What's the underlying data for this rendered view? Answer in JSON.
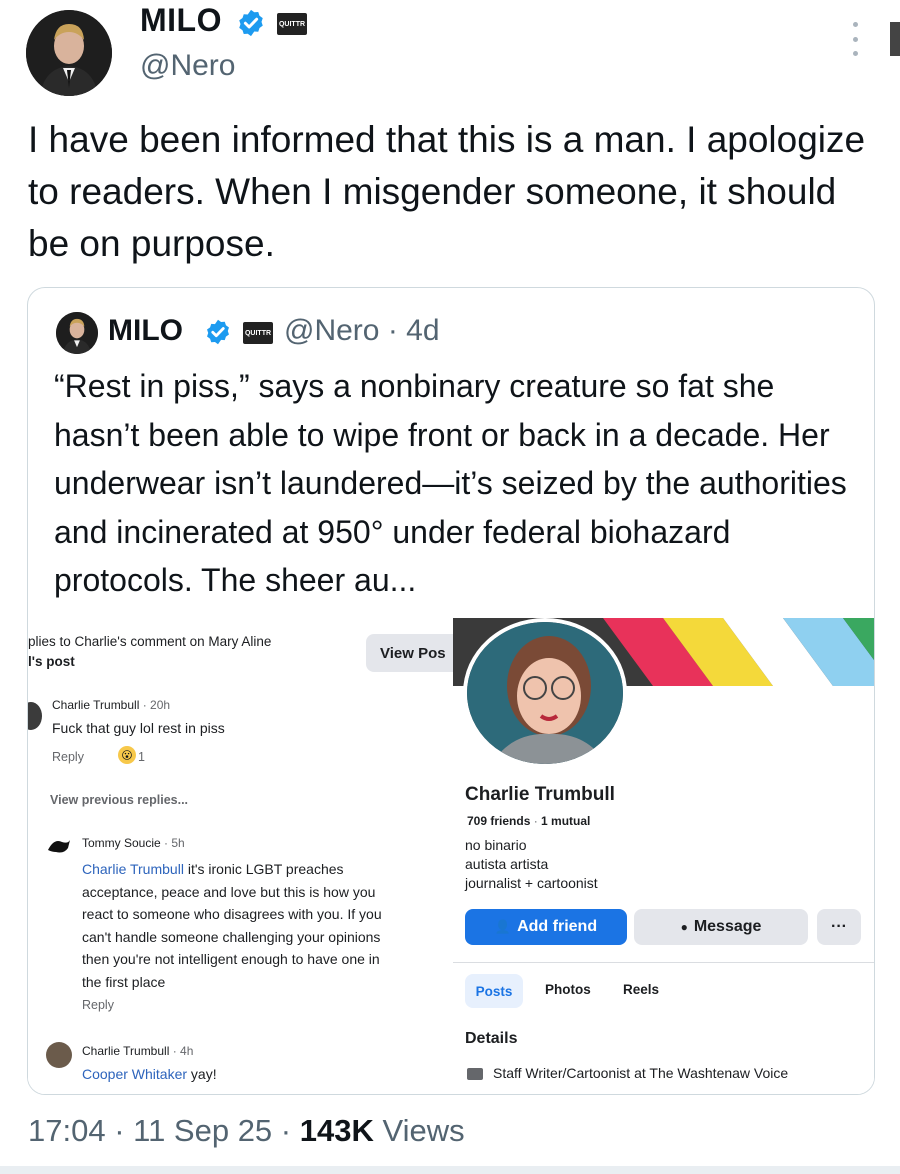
{
  "author": {
    "name": "MILO",
    "handle": "@Nero",
    "badge_box_text": "QUITTR"
  },
  "tweet": {
    "text": "I have been informed that this is a man. I apologize to readers. When I misgender someone, it should be on purpose."
  },
  "quote": {
    "name": "MILO",
    "handle": "@Nero · 4d",
    "badge_box_text": "QUITTR",
    "text": "“Rest in piss,” says a nonbinary creature so fat she hasn’t been able to wipe front or back in a decade. Her underwear isn’t laundered—it’s seized by the authorities and incinerated at 950° under federal biohazard protocols. The sheer au..."
  },
  "fb_comments": {
    "header_line1": "plies to Charlie's comment on Mary Aline",
    "header_line2": "l's post",
    "view_post_button": "View Pos",
    "comment1": {
      "author": "Charlie Trumbull",
      "time": "· 20h",
      "text": "Fuck that guy lol rest in piss",
      "reply": "Reply",
      "reaction_count": "1"
    },
    "view_previous": "View previous replies...",
    "comment2": {
      "author": "Tommy Soucie",
      "time": "· 5h",
      "mention": "Charlie Trumbull",
      "text_line1": " it's ironic LGBT preaches",
      "text_lines": [
        "acceptance, peace and love but this is how you",
        "react to someone who disagrees with you. If you",
        "can't handle someone challenging your opinions",
        "then you're not intelligent enough to have one in",
        "the first place"
      ],
      "reply": "Reply"
    },
    "comment3": {
      "author": "Charlie Trumbull",
      "time": "· 4h",
      "mention": "Cooper Whitaker",
      "text": " yay!"
    }
  },
  "fb_profile": {
    "name": "Charlie Trumbull",
    "friends": "709 friends",
    "mutual": "1 mutual",
    "bio": [
      "no binario",
      "autista artista",
      "journalist + cartoonist"
    ],
    "add_friend_button": "Add friend",
    "message_button": "Message",
    "more_button": "···",
    "tabs": [
      "Posts",
      "Photos",
      "Reels"
    ],
    "details_heading": "Details",
    "work": "Staff Writer/Cartoonist at The Washtenaw Voice",
    "banner_colors": [
      "#e8325a",
      "#f4d93a",
      "#ffffff",
      "#8fd0f0",
      "#3aa860"
    ]
  },
  "footer": {
    "time": "17:04 · 11 Sep 25 · ",
    "views_count": "143K",
    "views_label": " Views"
  },
  "colors": {
    "verified_blue": "#1d9bf0",
    "fb_blue": "#1b74e4",
    "muted": "#536471"
  }
}
